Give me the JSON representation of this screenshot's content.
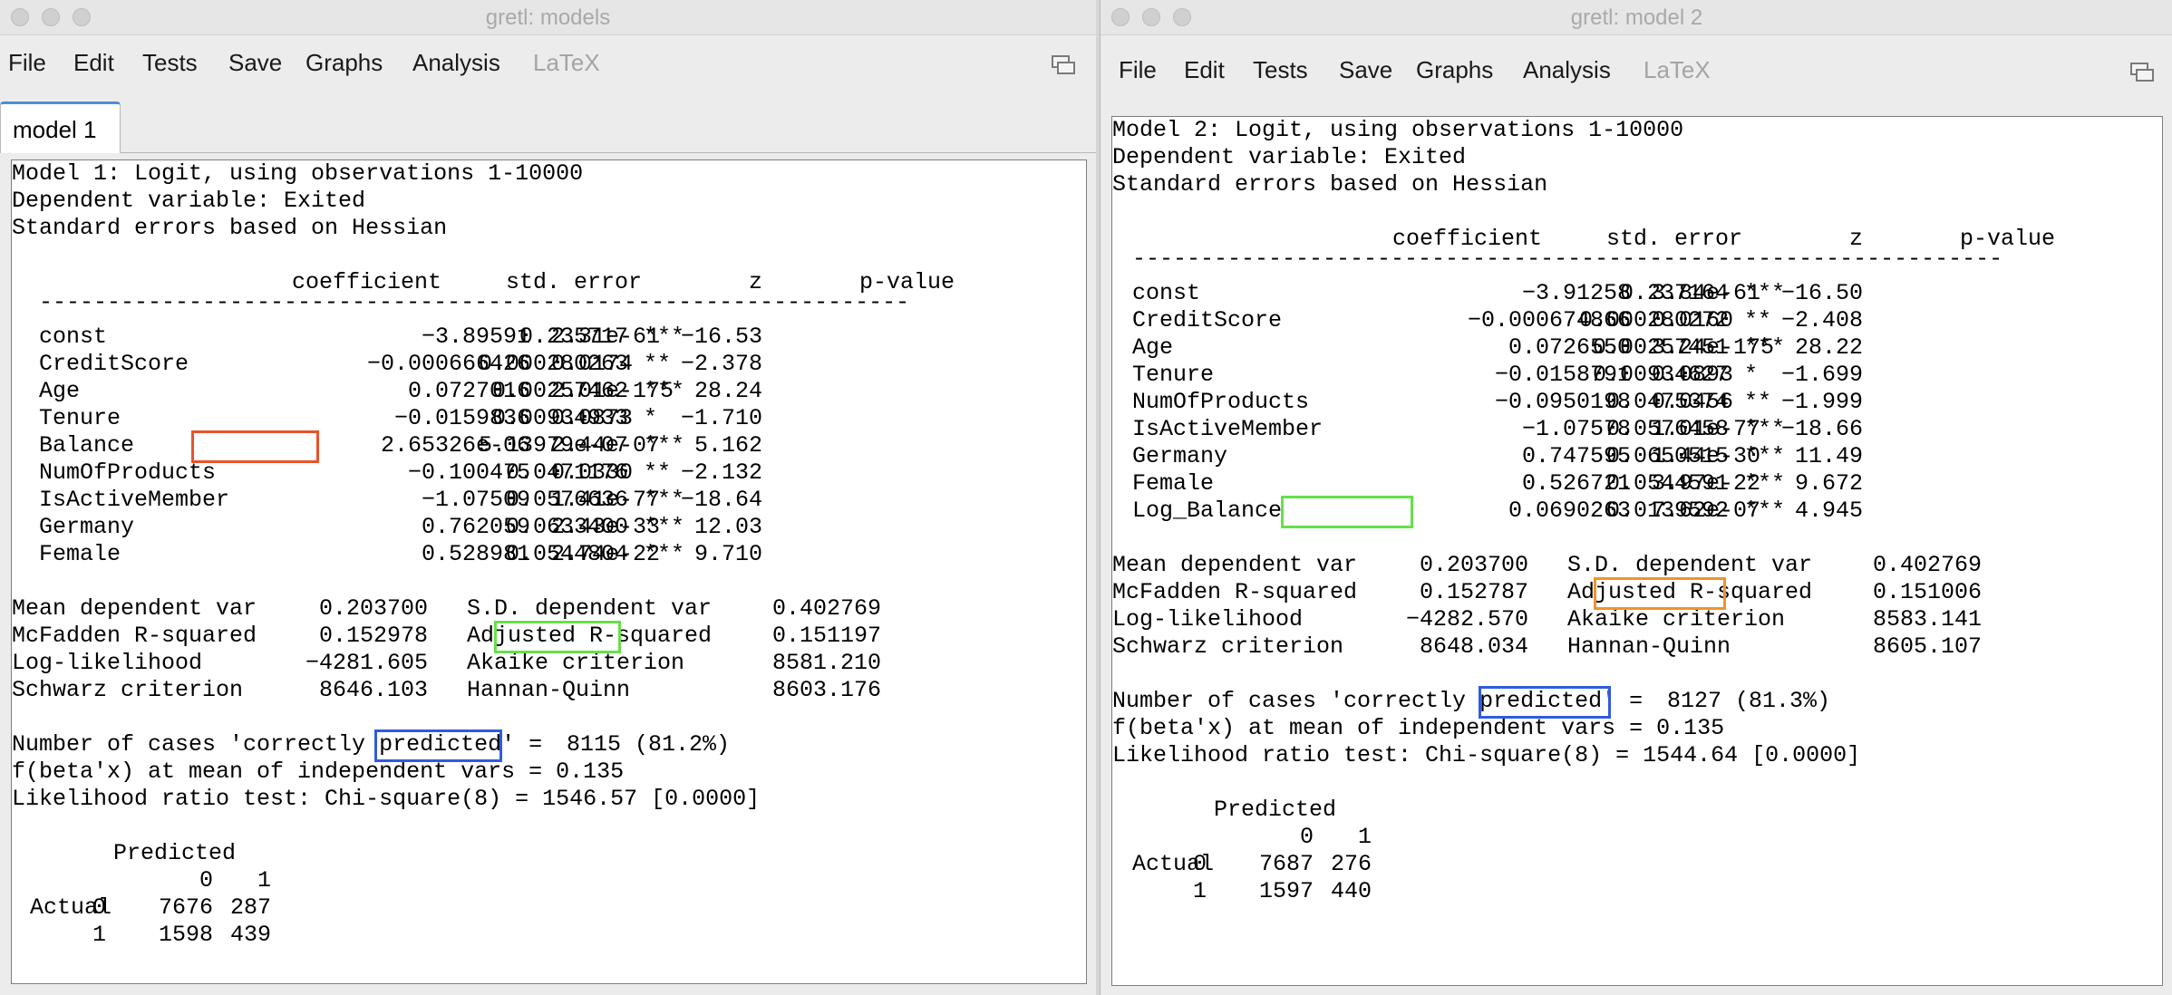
{
  "window1": {
    "title": "gretl: models",
    "menu": [
      "File",
      "Edit",
      "Tests",
      "Save",
      "Graphs",
      "Analysis",
      "LaTeX"
    ],
    "tab": "model 1",
    "header": [
      "Model 1: Logit, using observations 1-10000",
      "Dependent variable: Exited",
      "Standard errors based on Hessian"
    ],
    "col_headers": [
      "coefficient",
      "std. error",
      "z",
      "p-value"
    ],
    "separator": "----------------------------------------------------------------",
    "rows": [
      {
        "name": "const",
        "coef": "−3.89591",
        "se": "0.235717",
        "z": "−16.53",
        "p": "2.31e-61",
        "sig": "***"
      },
      {
        "name": "CreditScore",
        "coef": "−0.000666426",
        "se": "0.000280263",
        "z": "−2.378",
        "p": "0.0174",
        "sig": "**"
      },
      {
        "name": "Age",
        "coef": "0.0727016",
        "se": "0.00257462",
        "z": "28.24",
        "p": "2.01e-175",
        "sig": "***"
      },
      {
        "name": "Tenure",
        "coef": "−0.0159836",
        "se": "0.00934933",
        "z": "−1.710",
        "p": "0.0873",
        "sig": "*"
      },
      {
        "name": "Balance",
        "coef": "2.65326e-06",
        "se": "5.13979e-07",
        "z": "5.162",
        "p": "2.44e-07",
        "sig": "***"
      },
      {
        "name": "NumOfProducts",
        "coef": "−0.100475",
        "se": "0.0471176",
        "z": "−2.132",
        "p": "0.0330",
        "sig": "**"
      },
      {
        "name": "IsActiveMember",
        "coef": "−1.07509",
        "se": "0.0576636",
        "z": "−18.64",
        "p": "1.41e-77",
        "sig": "***"
      },
      {
        "name": "Germany",
        "coef": "0.762059",
        "se": "0.0633400",
        "z": "12.03",
        "p": "2.43e-33",
        "sig": "***"
      },
      {
        "name": "Female",
        "coef": "0.528981",
        "se": "0.0544804",
        "z": "9.710",
        "p": "2.74e-22",
        "sig": "***"
      }
    ],
    "stats": [
      [
        "Mean dependent var",
        "0.203700",
        "S.D. dependent var",
        "0.402769"
      ],
      [
        "McFadden R-squared",
        "0.152978",
        "Adjusted R-squared",
        "0.151197"
      ],
      [
        "Log-likelihood",
        "−4281.605",
        "Akaike criterion",
        "8581.210"
      ],
      [
        "Schwarz criterion",
        "8646.103",
        "Hannan-Quinn",
        "8603.176"
      ]
    ],
    "correct_label": "Number of cases 'correctly predicted' =",
    "correct_value": "8115 (81.2%)",
    "fbeta": "f(beta'x) at mean of independent vars = 0.135",
    "lr_test": "Likelihood ratio test: Chi-square(8) = 1546.57 [0.0000]",
    "confusion": {
      "title": "Predicted",
      "cols": [
        "0",
        "1"
      ],
      "row_label": "Actual",
      "rows": [
        [
          "0",
          "7676",
          "287"
        ],
        [
          "1",
          "1598",
          "439"
        ]
      ]
    },
    "highlights": [
      {
        "target": "Balance coefficient",
        "color": "#e8532a"
      },
      {
        "target": "Adjusted R-squared",
        "color": "#66e04a"
      },
      {
        "target": "correctly predicted",
        "color": "#2f5be0"
      }
    ]
  },
  "window2": {
    "title": "gretl: model 2",
    "menu": [
      "File",
      "Edit",
      "Tests",
      "Save",
      "Graphs",
      "Analysis",
      "LaTeX"
    ],
    "header": [
      "Model 2: Logit, using observations 1-10000",
      "Dependent variable: Exited",
      "Standard errors based on Hessian"
    ],
    "col_headers": [
      "coefficient",
      "std. error",
      "z",
      "p-value"
    ],
    "separator": "----------------------------------------------------------------",
    "rows": [
      {
        "name": "const",
        "coef": "−3.91258",
        "se": "0.237164",
        "z": "−16.50",
        "p": "3.84e-61",
        "sig": "***"
      },
      {
        "name": "CreditScore",
        "coef": "−0.000674866",
        "se": "0.000280272",
        "z": "−2.408",
        "p": "0.0160",
        "sig": "**"
      },
      {
        "name": "Age",
        "coef": "0.0726550",
        "se": "0.00257451",
        "z": "28.22",
        "p": "3.24e-175",
        "sig": "***"
      },
      {
        "name": "Tenure",
        "coef": "−0.0158791",
        "se": "0.00934627",
        "z": "−1.699",
        "p": "0.0893",
        "sig": "*"
      },
      {
        "name": "NumOfProducts",
        "coef": "−0.0950198",
        "se": "0.0475374",
        "z": "−1.999",
        "p": "0.0456",
        "sig": "**"
      },
      {
        "name": "IsActiveMember",
        "coef": "−1.07578",
        "se": "0.0576458",
        "z": "−18.66",
        "p": "1.01e-77",
        "sig": "***"
      },
      {
        "name": "Germany",
        "coef": "0.747595",
        "se": "0.0650515",
        "z": "11.49",
        "p": "1.44e-30",
        "sig": "***"
      },
      {
        "name": "Female",
        "coef": "0.526721",
        "se": "0.0544591",
        "z": "9.672",
        "p": "3.97e-22",
        "sig": "***"
      },
      {
        "name": "Log_Balance",
        "coef": "0.0690263",
        "se": "0.0139592",
        "z": "4.945",
        "p": "7.62e-07",
        "sig": "***"
      }
    ],
    "stats": [
      [
        "Mean dependent var",
        "0.203700",
        "S.D. dependent var",
        "0.402769"
      ],
      [
        "McFadden R-squared",
        "0.152787",
        "Adjusted R-squared",
        "0.151006"
      ],
      [
        "Log-likelihood",
        "−4282.570",
        "Akaike criterion",
        "8583.141"
      ],
      [
        "Schwarz criterion",
        "8648.034",
        "Hannan-Quinn",
        "8605.107"
      ]
    ],
    "correct_label": "Number of cases 'correctly predicted' =",
    "correct_value": "8127 (81.3%)",
    "fbeta": "f(beta'x) at mean of independent vars = 0.135",
    "lr_test": "Likelihood ratio test: Chi-square(8) = 1544.64 [0.0000]",
    "confusion": {
      "title": "Predicted",
      "cols": [
        "0",
        "1"
      ],
      "row_label": "Actual",
      "rows": [
        [
          "0",
          "7687",
          "276"
        ],
        [
          "1",
          "1597",
          "440"
        ]
      ]
    },
    "highlights": [
      {
        "target": "Log_Balance coefficient",
        "color": "#66e04a"
      },
      {
        "target": "Adjusted R-squared",
        "color": "#f0932b"
      },
      {
        "target": "correctly predicted",
        "color": "#2f5be0"
      }
    ]
  }
}
